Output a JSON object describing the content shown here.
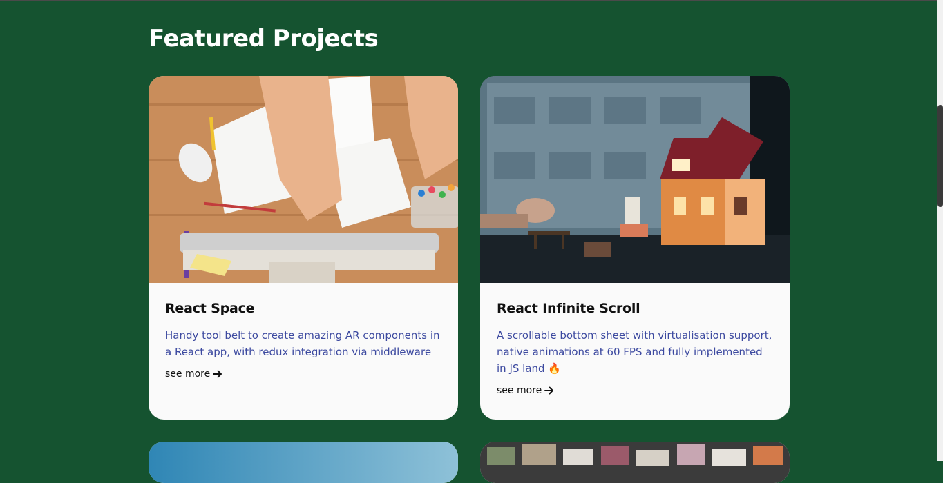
{
  "section": {
    "title": "Featured Projects"
  },
  "projects": [
    {
      "title": "React Space",
      "description": "Handy tool belt to create amazing AR components in a React app, with redux integration via middleware",
      "link_label": "see more"
    },
    {
      "title": "React Infinite Scroll",
      "description": "A scrollable bottom sheet with virtualisation support, native animations at 60 FPS and fully implemented in JS land 🔥",
      "link_label": "see more"
    }
  ],
  "colors": {
    "background": "#155330",
    "card": "#fafafa",
    "description": "#3d4aa0"
  }
}
